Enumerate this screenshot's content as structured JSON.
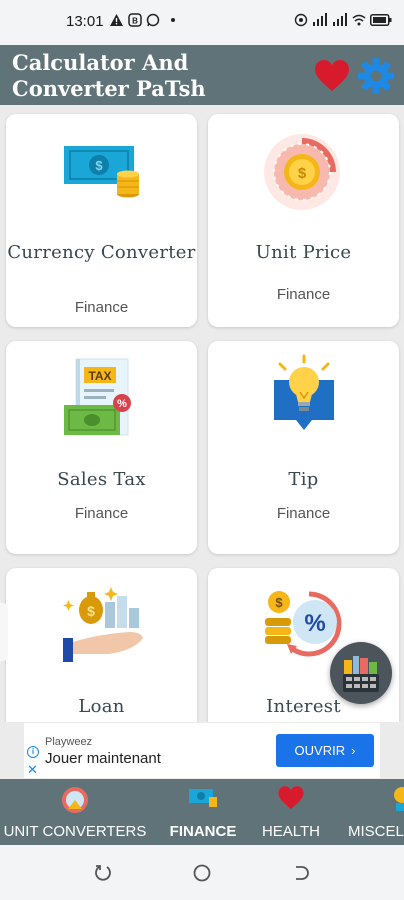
{
  "status": {
    "time": "13:01",
    "left_icons": [
      "warning-icon",
      "b-badge-icon",
      "whatsapp-icon",
      "dot-icon"
    ],
    "right_icons": [
      "hotspot-icon",
      "signal-icon",
      "signal-icon-2",
      "wifi-icon",
      "battery-icon"
    ]
  },
  "header": {
    "title": "Calculator And Converter PaTsh",
    "icons": [
      "heart-icon",
      "gear-icon"
    ],
    "colors": {
      "bar": "#5f7379",
      "heart": "#d81b2c",
      "gear": "#1e88e5"
    }
  },
  "cards": [
    {
      "title": "Currency Converter",
      "subtitle": "Finance",
      "icon": "money-icon"
    },
    {
      "title": "Unit Price",
      "subtitle": "Finance",
      "icon": "coin-chart-icon"
    },
    {
      "title": "Sales Tax",
      "subtitle": "Finance",
      "icon": "tax-document-icon"
    },
    {
      "title": "Tip",
      "subtitle": "Finance",
      "icon": "lightbulb-icon"
    },
    {
      "title": "Loan",
      "subtitle": "",
      "icon": "hand-money-icon"
    },
    {
      "title": "Interest",
      "subtitle": "",
      "icon": "percent-coins-icon"
    }
  ],
  "ad": {
    "sponsor": "Playweez",
    "headline": "Jouer maintenant",
    "cta": "OUVRIR"
  },
  "bottom_nav": [
    {
      "label": "UNIT CONVERTERS",
      "icon": "ruler-gauge-icon",
      "active": false
    },
    {
      "label": "FINANCE",
      "icon": "money-icon",
      "active": true
    },
    {
      "label": "HEALTH",
      "icon": "heart-icon",
      "active": false
    },
    {
      "label": "MISCEL",
      "icon": "misc-icon",
      "active": false
    }
  ]
}
